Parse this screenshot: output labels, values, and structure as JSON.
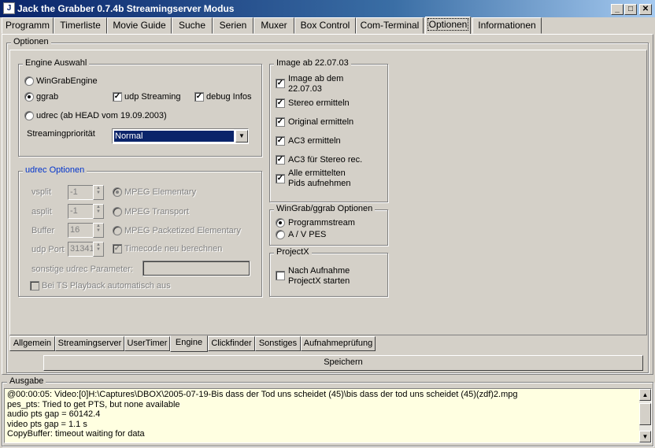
{
  "window": {
    "title": "Jack the Grabber 0.7.4b Streamingserver Modus",
    "minimize": "_",
    "maximize": "□",
    "close": "✕"
  },
  "tabs": [
    "Programm",
    "Timerliste",
    "Movie Guide",
    "Suche",
    "Serien",
    "Muxer",
    "Box Control",
    "Com-Terminal",
    "Optionen",
    "Informationen"
  ],
  "optionen_label": "Optionen",
  "engine": {
    "label": "Engine Auswahl",
    "winGrab": "WinGrabEngine",
    "ggrab": "ggrab",
    "udp_streaming": "udp Streaming",
    "debug_infos": "debug Infos",
    "udrec": "udrec (ab HEAD vom 19.09.2003)",
    "prio_label": "Streamingpriorität",
    "prio_value": "Normal"
  },
  "udrec": {
    "label": "udrec Optionen",
    "vsplit": "vsplit",
    "vsplit_val": "-1",
    "asplit": "asplit",
    "asplit_val": "-1",
    "buffer": "Buffer",
    "buffer_val": "16",
    "udp_port": "udp Port",
    "udp_port_val": "31341",
    "mpeg_elem": "MPEG Elementary",
    "mpeg_transport": "MPEG Transport",
    "mpeg_pes": "MPEG Packetized Elementary",
    "timecode": "Timecode neu berechnen",
    "sonstige": "sonstige udrec Parameter:",
    "ts_playback": "Bei TS Playback automatisch aus"
  },
  "image": {
    "label": "Image ab 22.07.03",
    "items": [
      "Image ab dem",
      "22.07.03",
      "Stereo ermitteln",
      "Original ermitteln",
      "AC3 ermitteln",
      "AC3 für Stereo rec.",
      "Alle ermittelten",
      "Pids aufnehmen"
    ]
  },
  "wingrab": {
    "label": "WinGrab/ggrab Optionen",
    "programmstream": "Programmstream",
    "avpes": "A / V PES"
  },
  "projectx": {
    "label": "ProjectX",
    "nach1": "Nach Aufnahme",
    "nach2": "ProjectX starten"
  },
  "bottom_tabs": [
    "Allgemein",
    "Streamingserver",
    "UserTimer",
    "Engine",
    "Clickfinder",
    "Sonstiges",
    "Aufnahmeprüfung"
  ],
  "save": "Speichern",
  "ausgabe": {
    "label": "Ausgabe",
    "lines": [
      "@00:00:05: Video:[0]H:\\Captures\\DBOX\\2005-07-19-Bis dass der Tod uns scheidet (45)\\bis dass der tod uns scheidet (45)(zdf)2.mpg",
      "pes_pts: Tried to get PTS, but none available",
      "audio pts gap =    60142.4",
      "video pts gap =        1.1 s",
      "CopyBuffer: timeout waiting for data"
    ]
  }
}
